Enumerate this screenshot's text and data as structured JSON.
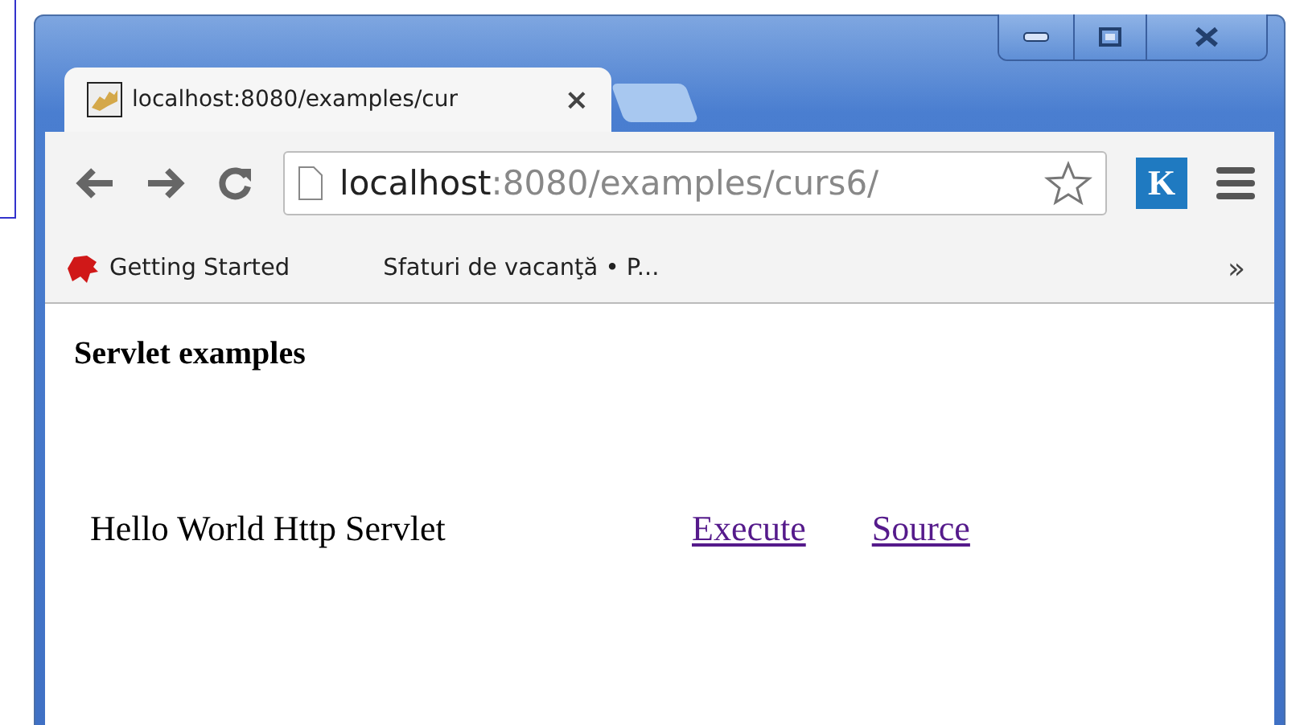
{
  "tab": {
    "title": "localhost:8080/examples/cur",
    "close": "×"
  },
  "address": {
    "host": "localhost",
    "path": ":8080/examples/curs6/"
  },
  "extension": {
    "label": "K"
  },
  "bookmarks": [
    {
      "label": "Getting Started",
      "kind": "icon"
    },
    {
      "label": "Sfaturi de vacanţă • P...",
      "kind": "plain"
    }
  ],
  "bookmarks_more": "»",
  "page": {
    "heading": "Servlet examples",
    "rows": [
      {
        "name": "Hello World Http Servlet",
        "links": [
          "Execute",
          "Source"
        ]
      }
    ]
  }
}
